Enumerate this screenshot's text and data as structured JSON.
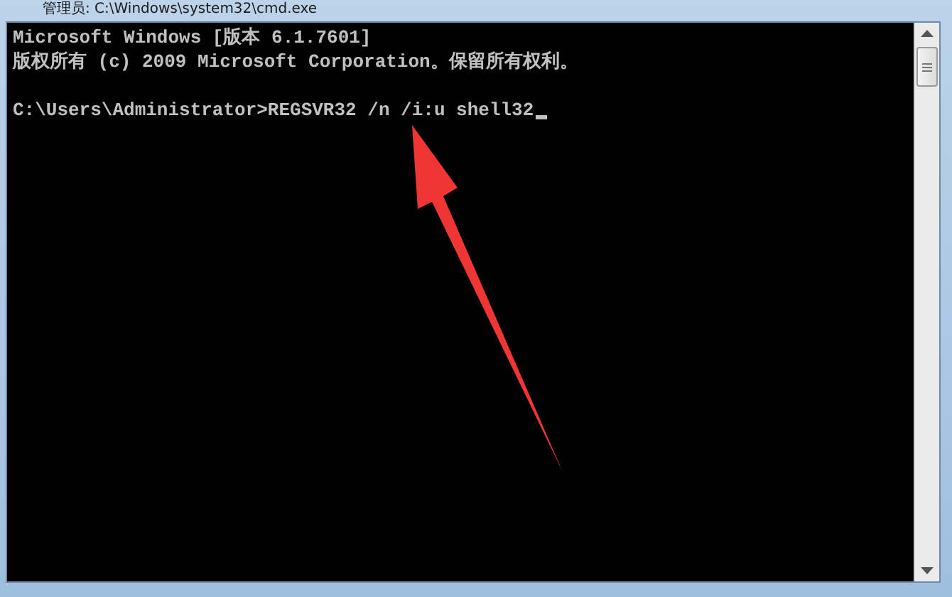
{
  "window": {
    "title": "管理员: C:\\Windows\\system32\\cmd.exe"
  },
  "console": {
    "blocks": [
      {
        "lines": [
          "Microsoft Windows [版本 6.1.7601]",
          "版权所有 (c) 2009 Microsoft Corporation。保留所有权利。"
        ]
      },
      {
        "lines": [
          "C:\\Users\\Administrator>REGSVR32 /n /i:u shell32"
        ]
      }
    ]
  }
}
